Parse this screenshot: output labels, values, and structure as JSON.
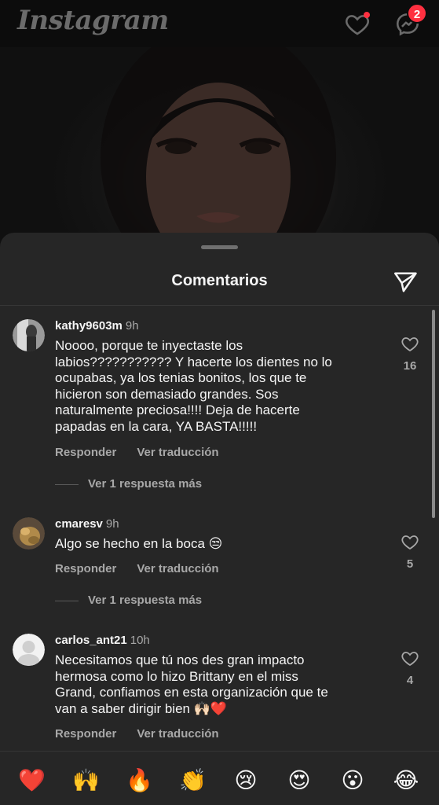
{
  "app": {
    "logo_text": "Instagram",
    "messages_badge": "2"
  },
  "sheet": {
    "title": "Comentarios"
  },
  "comments": [
    {
      "username": "kathy9603m",
      "time": "9h",
      "text": "Noooo, porque te inyectaste los\nlabios??????????? Y hacerte los dientes no lo\nocupabas, ya los tenias bonitos, los que te\nhicieron son demasiado grandes. Sos\nnaturalmente preciosa!!!! Deja de hacerte\npapadas en la cara, YA BASTA!!!!!",
      "likes": "16",
      "reply_label": "Responder",
      "translate_label": "Ver traducción",
      "more_replies": "Ver 1 respuesta más"
    },
    {
      "username": "cmaresv",
      "time": "9h",
      "text": "Algo se hecho en la boca 😒",
      "likes": "5",
      "reply_label": "Responder",
      "translate_label": "Ver traducción",
      "more_replies": "Ver 1 respuesta más"
    },
    {
      "username": "carlos_ant21",
      "time": "10h",
      "text": "Necesitamos que tú nos des gran impacto\nhermosa como lo hizo Brittany en el miss\nGrand, confiamos en esta organización que te\nvan a saber dirigir bien 🙌🏻❤️",
      "likes": "4",
      "reply_label": "Responder",
      "translate_label": "Ver traducción"
    }
  ],
  "emoji_bar": [
    "❤️",
    "🙌",
    "🔥",
    "👏",
    "😢",
    "😍",
    "😮",
    "😂"
  ],
  "colors": {
    "accent_red": "#ff3040",
    "sheet_bg": "#262626",
    "secondary_text": "#a8a8a8"
  }
}
